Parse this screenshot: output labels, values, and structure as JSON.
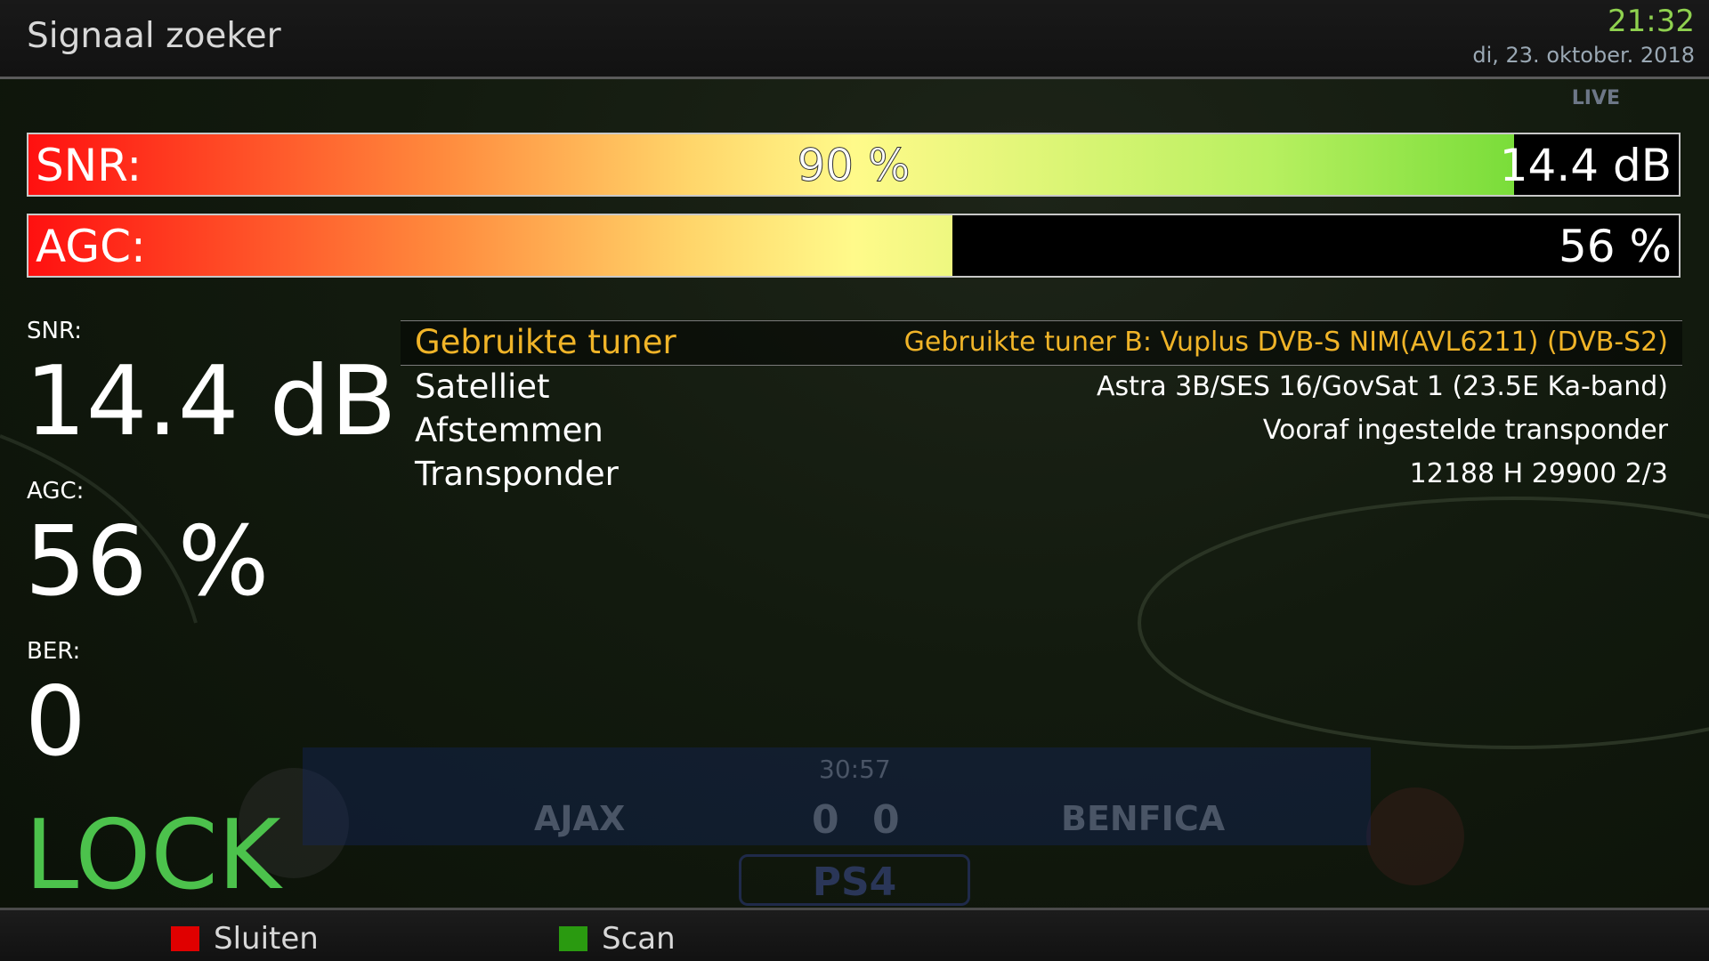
{
  "header": {
    "title": "Signaal zoeker",
    "time": "21:32",
    "date": "di, 23. oktober. 2018",
    "channel_logo_text": "LIVE"
  },
  "bars": {
    "snr": {
      "label": "SNR:",
      "percent_text": "90 %",
      "value_text": "14.4 dB",
      "fill_percent": 90
    },
    "agc": {
      "label": "AGC:",
      "value_text": "56 %",
      "fill_percent": 56
    }
  },
  "readouts": {
    "snr_label": "SNR:",
    "snr_value": "14.4 dB",
    "agc_label": "AGC:",
    "agc_value": "56 %",
    "ber_label": "BER:",
    "ber_value": "0",
    "lock_text": "LOCK"
  },
  "info": [
    {
      "key": "Gebruikte tuner",
      "value": "Gebruikte tuner B: Vuplus DVB-S NIM(AVL6211) (DVB-S2)"
    },
    {
      "key": "Satelliet",
      "value": "Astra 3B/SES 16/GovSat 1 (23.5E Ka-band)"
    },
    {
      "key": "Afstemmen",
      "value": "Vooraf ingestelde transponder"
    },
    {
      "key": "Transponder",
      "value": "12188 H 29900 2/3"
    }
  ],
  "scoreboard": {
    "time": "30:57",
    "home": "AJAX",
    "home_score": "0",
    "away_score": "0",
    "away": "BENFICA",
    "sponsor": "PS4"
  },
  "footer": {
    "red_label": "Sluiten",
    "green_label": "Scan"
  },
  "colors": {
    "accent_selected": "#f0b428",
    "lock": "#4cc24c",
    "red_key": "#e00000",
    "green_key": "#2a9a10",
    "clock": "#8fd14f"
  }
}
